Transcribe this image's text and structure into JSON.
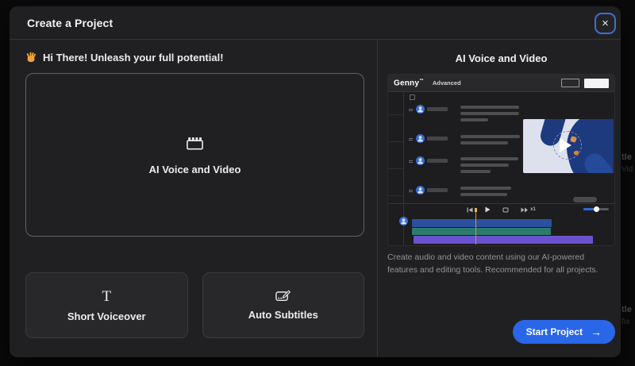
{
  "modal": {
    "title": "Create a Project",
    "close_glyph": "×"
  },
  "left_panel": {
    "greeting": {
      "emoji": "👋",
      "text": "Hi There! Unleash your full potential!"
    },
    "primary_card": {
      "label": "AI Voice and Video",
      "icon": "clapperboard-icon"
    },
    "secondary_cards": [
      {
        "label": "Short Voiceover",
        "icon_glyph": "T"
      },
      {
        "label": "Auto Subtitles",
        "icon": "subtitle-edit-icon"
      }
    ]
  },
  "right_panel": {
    "title": "AI Voice and Video",
    "preview": {
      "brand": "Genny",
      "brand_mark": "™",
      "mode_label": "Advanced",
      "speed_label": "x1"
    },
    "description": "Create audio and video content using our AI-powered features and editing tools. Recommended for all projects.",
    "start_button": {
      "label": "Start Project",
      "arrow": "→"
    }
  },
  "backdrop_fragments": [
    "tle",
    "Vid",
    "tle",
    "fia"
  ],
  "colors": {
    "accent_blue": "#2a66e8",
    "close_focus_ring": "#3e6fd0",
    "timeline_track_blue": "#2b509f",
    "timeline_track_teal": "#2e7a6c",
    "timeline_track_purple": "#6a52cf",
    "playhead_yellow": "#c69a3f",
    "thumb_hand_navy": "#1d3a7e",
    "thumb_bg": "#dde1ee"
  }
}
